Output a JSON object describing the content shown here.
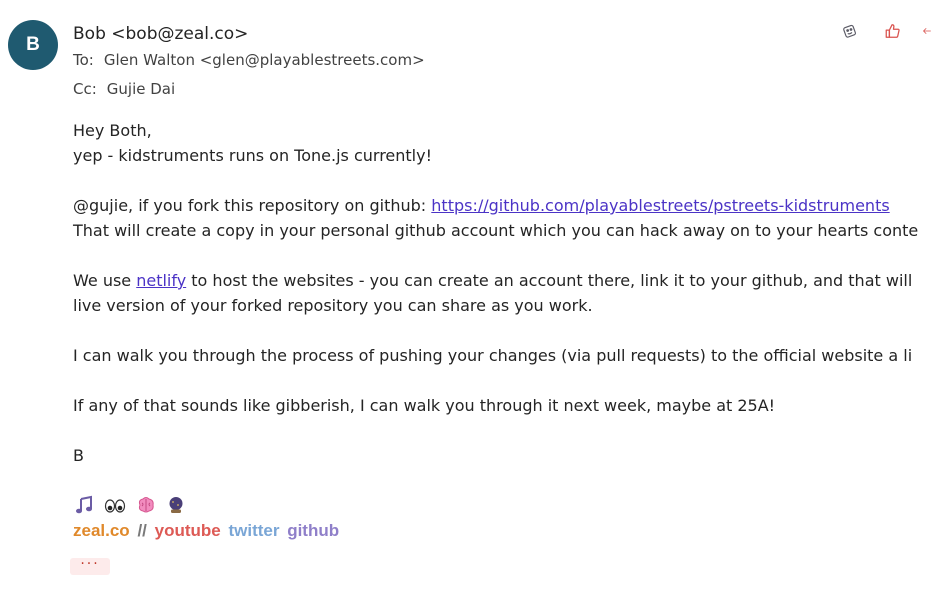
{
  "sender": {
    "initial": "B",
    "display": "Bob <bob@zeal.co>",
    "avatar_color": "#1f5a70"
  },
  "recipients": {
    "to_label": "To:",
    "to_value": "Glen Walton <glen@playablestreets.com>",
    "cc_label": "Cc:",
    "cc_value": "Gujie Dai"
  },
  "actions": [
    "sticker-icon",
    "like-icon",
    "reply-icon"
  ],
  "body": {
    "greeting": "Hey Both,",
    "line1": "yep - kidstruments runs on Tone.js currently!",
    "p2_prefix": "@gujie, if you fork this repository on github: ",
    "p2_link": "https://github.com/playablestreets/pstreets-kidstruments",
    "p2_line2": "That will create a copy in your personal github account which you can hack away on to your hearts conte",
    "p3_prefix": "We use ",
    "p3_link": "netlify",
    "p3_suffix": " to host the websites - you can create an account there, link it to your github, and that will",
    "p3_line2": "live version of your forked repository you can share as you work.",
    "p4": "I can walk you through the process of pushing your changes (via pull requests) to the official website a li",
    "p5": "If any of that sounds like gibberish, I can walk you through it next week, maybe at 25A!",
    "signoff": "B"
  },
  "signature": {
    "emojis": [
      "music-note-icon",
      "eyes-icon",
      "brain-icon",
      "crystal-ball-icon"
    ],
    "site": "zeal.co",
    "separator": "//",
    "youtube": "youtube",
    "twitter": "twitter",
    "github": "github",
    "colors": {
      "site": "#e0892b",
      "separator": "#7a7a7a",
      "youtube": "#dd5a55",
      "twitter": "#7aa6d6",
      "github": "#8f7fc9"
    }
  },
  "more_label": "···"
}
